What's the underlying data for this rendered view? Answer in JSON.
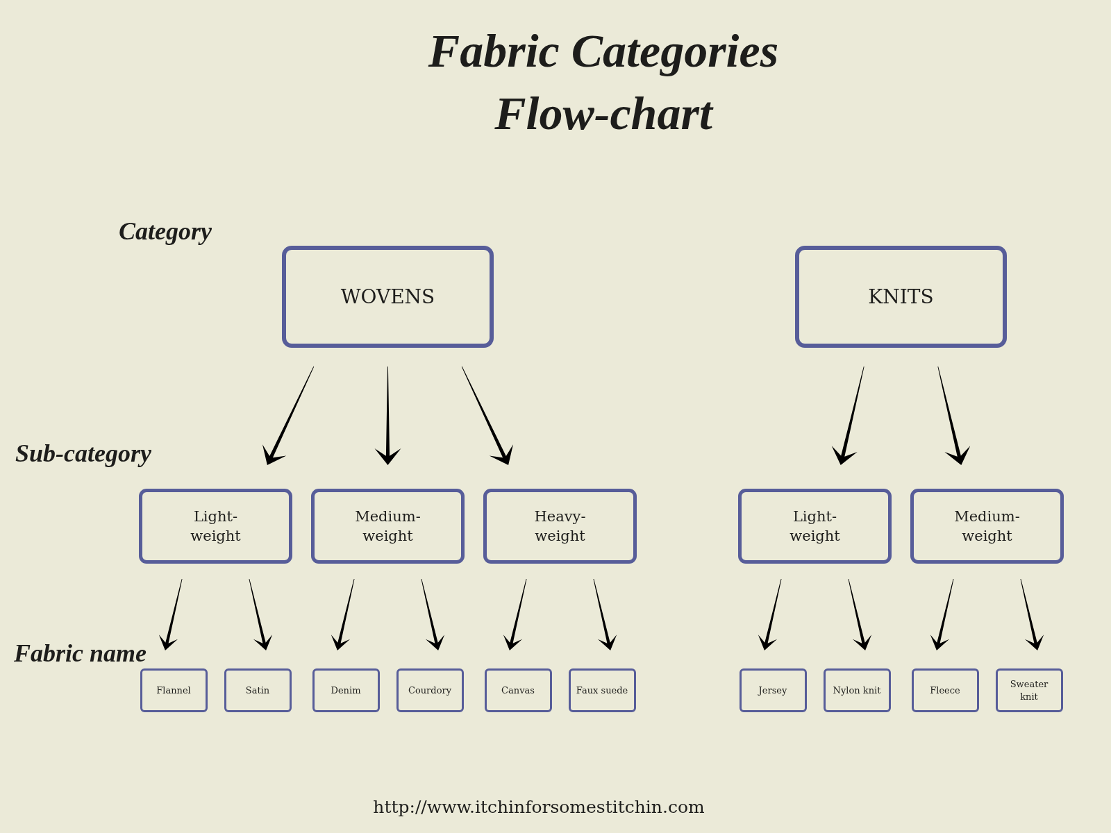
{
  "title": "Fabric Categories Flow-chart",
  "row_labels": [
    "Category",
    "Sub-category",
    "Fabric name"
  ],
  "categories": [
    {
      "label": "WOVENS",
      "children": [
        {
          "label": "Light-weight",
          "children": [
            {
              "label": "Flannel"
            },
            {
              "label": "Satin"
            }
          ]
        },
        {
          "label": "Medium-weight",
          "children": [
            {
              "label": "Denim"
            },
            {
              "label": "Courdory"
            }
          ]
        },
        {
          "label": "Heavy-weight",
          "children": [
            {
              "label": "Canvas"
            },
            {
              "label": "Faux suede"
            }
          ]
        }
      ]
    },
    {
      "label": "KNITS",
      "children": [
        {
          "label": "Light-weight",
          "children": [
            {
              "label": "Jersey"
            },
            {
              "label": "Nylon knit"
            }
          ]
        },
        {
          "label": "Medium-weight",
          "children": [
            {
              "label": "Fleece"
            },
            {
              "label": "Sweater knit"
            }
          ]
        }
      ]
    }
  ],
  "footer": {
    "url": "http://www.itchinforsomestitchin.com"
  }
}
